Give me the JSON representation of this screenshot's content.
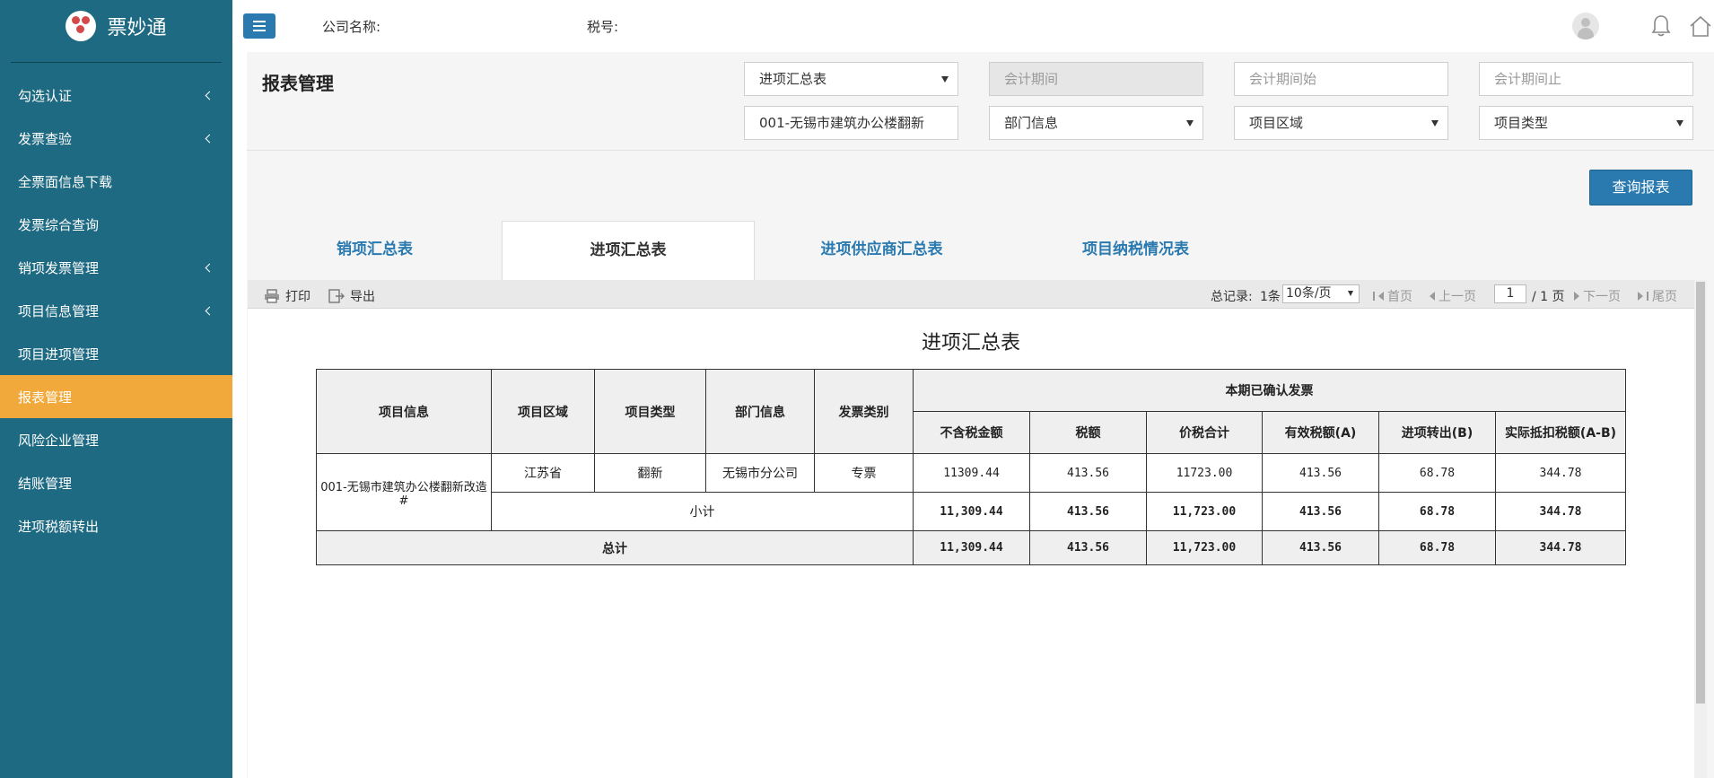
{
  "sidebar": {
    "brand": "票妙通",
    "items": [
      {
        "label": "勾选认证",
        "has_children": true
      },
      {
        "label": "发票查验",
        "has_children": true
      },
      {
        "label": "全票面信息下载",
        "has_children": false
      },
      {
        "label": "发票综合查询",
        "has_children": false
      },
      {
        "label": "销项发票管理",
        "has_children": true
      },
      {
        "label": "项目信息管理",
        "has_children": true
      },
      {
        "label": "项目进项管理",
        "has_children": false
      },
      {
        "label": "报表管理",
        "has_children": false,
        "active": true
      },
      {
        "label": "风险企业管理",
        "has_children": false
      },
      {
        "label": "结账管理",
        "has_children": false
      },
      {
        "label": "进项税额转出",
        "has_children": false
      }
    ]
  },
  "topbar": {
    "company_label": "公司名称:",
    "tax_label": "税号:"
  },
  "filters": {
    "page_title": "报表管理",
    "report_type": "进项汇总表",
    "period_placeholder": "会计期间",
    "period_start_placeholder": "会计期间始",
    "period_end_placeholder": "会计期间止",
    "project": "001-无锡市建筑办公楼翻新",
    "department": "部门信息",
    "region": "项目区域",
    "project_type": "项目类型",
    "query_button": "查询报表"
  },
  "tabs": [
    {
      "label": "销项汇总表",
      "active": false
    },
    {
      "label": "进项汇总表",
      "active": true
    },
    {
      "label": "进项供应商汇总表",
      "active": false
    },
    {
      "label": "项目纳税情况表",
      "active": false
    }
  ],
  "toolbar": {
    "print": "打印",
    "export": "导出",
    "total_records_label": "总记录:",
    "total_records_value": "1条",
    "page_size": "10条/页",
    "first": "首页",
    "prev": "上一页",
    "current_page": "1",
    "total_pages": "/ 1 页",
    "next": "下一页",
    "last": "尾页"
  },
  "report": {
    "title": "进项汇总表",
    "headers": {
      "project_info": "项目信息",
      "region": "项目区域",
      "type": "项目类型",
      "department": "部门信息",
      "invoice_category": "发票类别",
      "group": "本期已确认发票",
      "amount_ex_tax": "不含税金额",
      "tax": "税额",
      "total": "价税合计",
      "effective_tax": "有效税额(A)",
      "tax_out": "进项转出(B)",
      "actual_deduct": "实际抵扣税额(A-B)"
    },
    "rows": [
      {
        "project": "001-无锡市建筑办公楼翻新改造#",
        "region": "江苏省",
        "type": "翻新",
        "department": "无锡市分公司",
        "category": "专票",
        "amount_ex_tax": "11309.44",
        "tax": "413.56",
        "total": "11723.00",
        "effective_tax": "413.56",
        "tax_out": "68.78",
        "actual_deduct": "344.78"
      }
    ],
    "subtotal": {
      "label": "小计",
      "amount_ex_tax": "11,309.44",
      "tax": "413.56",
      "total": "11,723.00",
      "effective_tax": "413.56",
      "tax_out": "68.78",
      "actual_deduct": "344.78"
    },
    "grand_total": {
      "label": "总计",
      "amount_ex_tax": "11,309.44",
      "tax": "413.56",
      "total": "11,723.00",
      "effective_tax": "413.56",
      "tax_out": "68.78",
      "actual_deduct": "344.78"
    }
  },
  "colors": {
    "sidebar_bg": "#1e6a82",
    "active_nav": "#f0a93a",
    "primary": "#2a7ab0"
  }
}
